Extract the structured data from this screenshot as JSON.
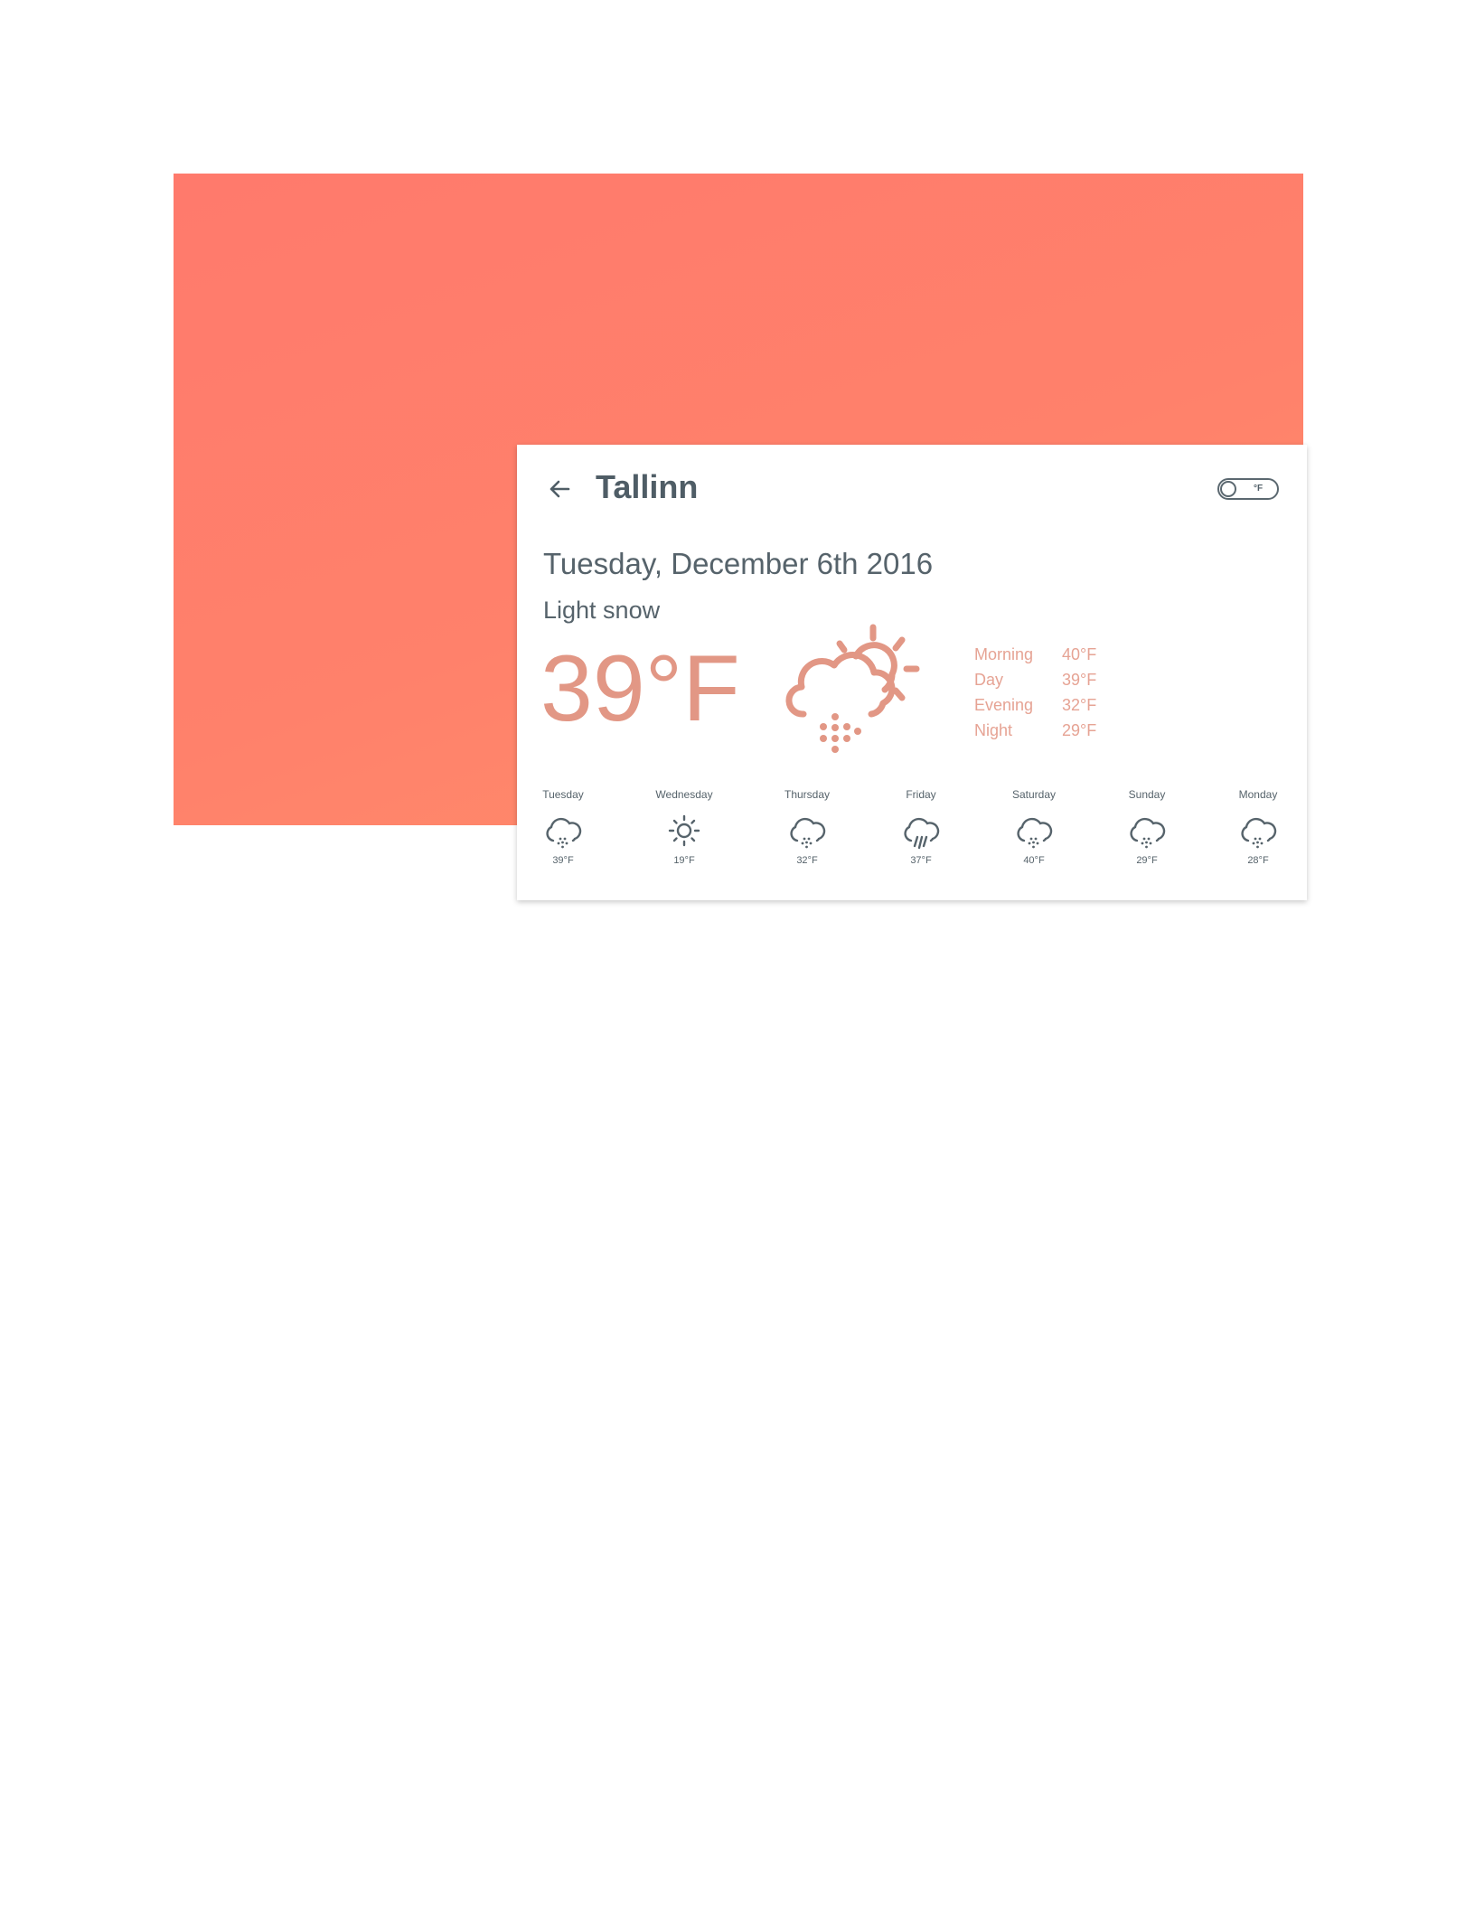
{
  "header": {
    "back_icon": "arrow-left-icon",
    "city": "Tallinn",
    "unit_toggle_label": "°F"
  },
  "today": {
    "date": "Tuesday, December 6th 2016",
    "condition": "Light snow",
    "temperature": "39°F",
    "icon": "partly-cloudy-snow-icon",
    "periods": [
      {
        "name": "Morning",
        "temp": "40°F"
      },
      {
        "name": "Day",
        "temp": "39°F"
      },
      {
        "name": "Evening",
        "temp": "32°F"
      },
      {
        "name": "Night",
        "temp": "29°F"
      }
    ]
  },
  "forecast": [
    {
      "day": "Tuesday",
      "temp": "39°F",
      "icon": "cloud-snow-icon"
    },
    {
      "day": "Wednesday",
      "temp": "19°F",
      "icon": "sun-icon"
    },
    {
      "day": "Thursday",
      "temp": "32°F",
      "icon": "cloud-snow-icon"
    },
    {
      "day": "Friday",
      "temp": "37°F",
      "icon": "cloud-rain-icon"
    },
    {
      "day": "Saturday",
      "temp": "40°F",
      "icon": "cloud-snow-icon"
    },
    {
      "day": "Sunday",
      "temp": "29°F",
      "icon": "cloud-snow-icon"
    },
    {
      "day": "Monday",
      "temp": "28°F",
      "icon": "cloud-snow-icon"
    }
  ],
  "colors": {
    "background_gradient_start": "#ff7a6c",
    "background_gradient_end": "#ff8f6a",
    "accent": "#e29785",
    "text": "#4f5d66"
  }
}
